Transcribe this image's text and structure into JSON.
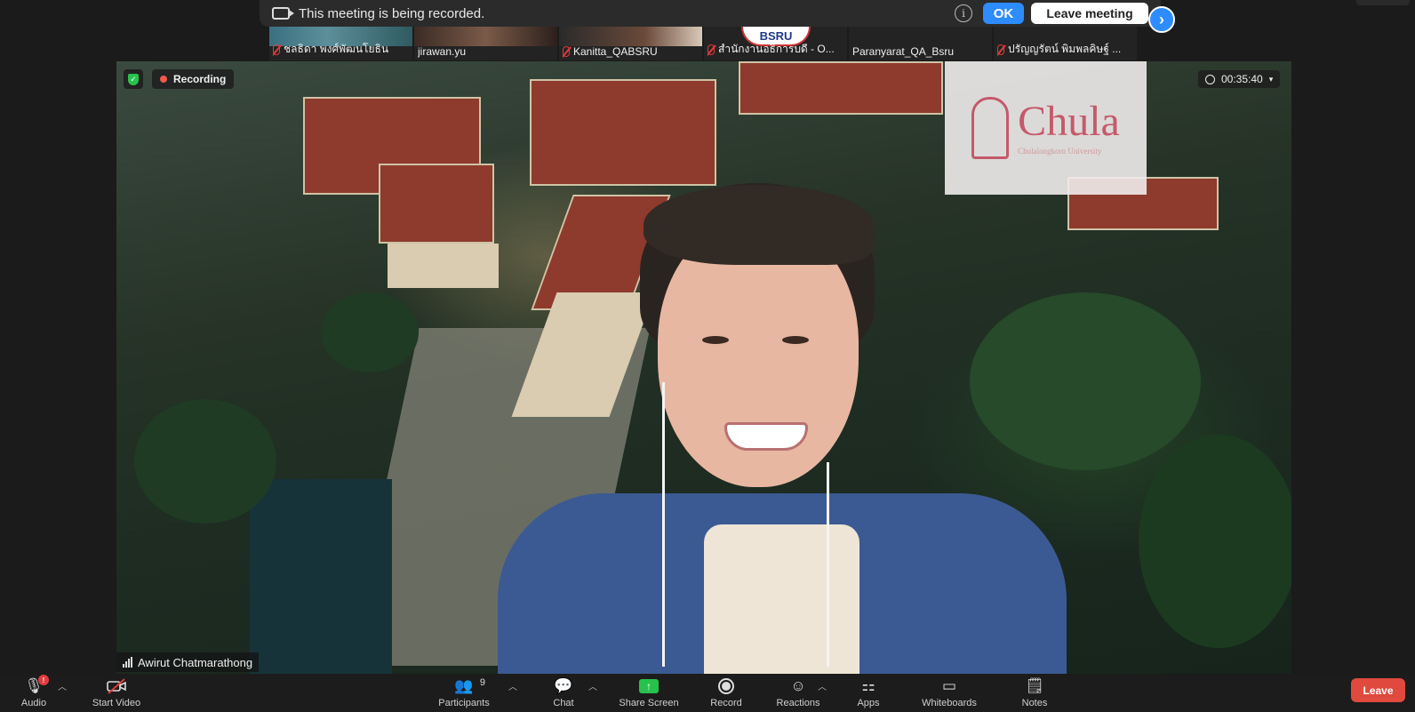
{
  "banner": {
    "message": "This meeting is being recorded.",
    "info_glyph": "i",
    "ok_label": "OK",
    "leave_meeting_label": "Leave meeting"
  },
  "thumbnails": [
    {
      "name": "ชลธิดา พงศ์พัฒนโยธิน",
      "muted": true
    },
    {
      "name": "jirawan.yu",
      "muted": false
    },
    {
      "name": "Kanitta_QABSRU",
      "muted": true
    },
    {
      "name": "สำนักงานอธิการบดี - O...",
      "muted": true,
      "logo_text": "BSRU"
    },
    {
      "name": "Paranyarat_QA_Bsru",
      "muted": false
    },
    {
      "name": "ปรัญญรัตน์ พิมพลคิษฐ์ ...",
      "muted": true
    }
  ],
  "video": {
    "recording_label": "Recording",
    "timer": "00:35:40",
    "speaker_name": "Awirut Chatmarathong",
    "logo_text": "Chula",
    "logo_subtext": "Chulalongkorn University"
  },
  "toolbar": {
    "audio_label": "Audio",
    "audio_badge": "!",
    "start_video_label": "Start Video",
    "participants_label": "Participants",
    "participants_count": "9",
    "chat_label": "Chat",
    "share_screen_label": "Share Screen",
    "record_label": "Record",
    "reactions_label": "Reactions",
    "apps_label": "Apps",
    "whiteboards_label": "Whiteboards",
    "notes_label": "Notes",
    "leave_label": "Leave"
  },
  "colors": {
    "accent_blue": "#2d8cff",
    "leave_red": "#e0493e",
    "share_green": "#27c24c",
    "muted_red": "#e23b3b"
  }
}
